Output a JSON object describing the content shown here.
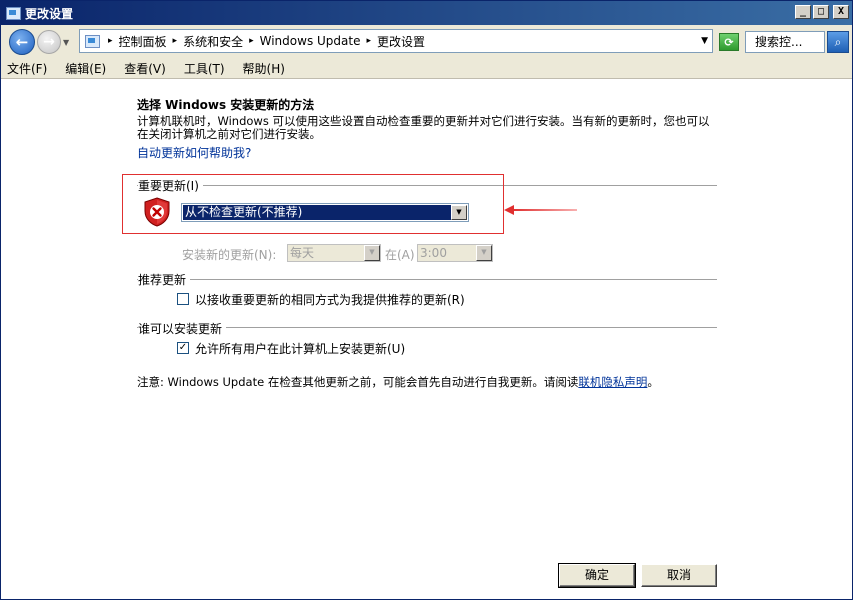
{
  "window": {
    "title": "更改设置",
    "controls": {
      "minimize": "_",
      "maximize": "□",
      "close": "X"
    }
  },
  "address": {
    "crumbs": [
      "控制面板",
      "系统和安全",
      "Windows Update",
      "更改设置"
    ],
    "separator": "▸",
    "search_placeholder": "搜索控...",
    "icons": [
      "back-arrow-icon",
      "forward-arrow-icon",
      "control-panel-icon",
      "refresh-icon",
      "search-icon"
    ]
  },
  "menu": {
    "items": [
      "文件(F)",
      "编辑(E)",
      "查看(V)",
      "工具(T)",
      "帮助(H)"
    ]
  },
  "content": {
    "heading": "选择 Windows 安装更新的方法",
    "description": "计算机联机时，Windows 可以使用这些设置自动检查重要的更新并对它们进行安装。当有新的更新时，您也可以在关闭计算机之前对它们进行安装。",
    "help_link": "自动更新如何帮助我?",
    "important": {
      "label": "重要更新(I)",
      "selected": "从不检查更新(不推荐)",
      "install_label": "安装新的更新(N):",
      "day_value": "每天",
      "at_label": "在(A)",
      "time_value": "3:00"
    },
    "recommended": {
      "label": "推荐更新",
      "checkbox_label": "以接收重要更新的相同方式为我提供推荐的更新(R)",
      "checked": false
    },
    "who": {
      "label": "谁可以安装更新",
      "checkbox_label": "允许所有用户在此计算机上安装更新(U)",
      "checked": true
    },
    "note_prefix": "注意: Windows Update 在检查其他更新之前，可能会首先自动进行自我更新。请阅读",
    "note_link": "联机隐私声明",
    "note_suffix": "。"
  },
  "buttons": {
    "ok": "确定",
    "cancel": "取消"
  },
  "colors": {
    "title_bar": "#0a246a",
    "selection": "#0a246a",
    "link": "#003399",
    "highlight_box": "#e03030"
  }
}
